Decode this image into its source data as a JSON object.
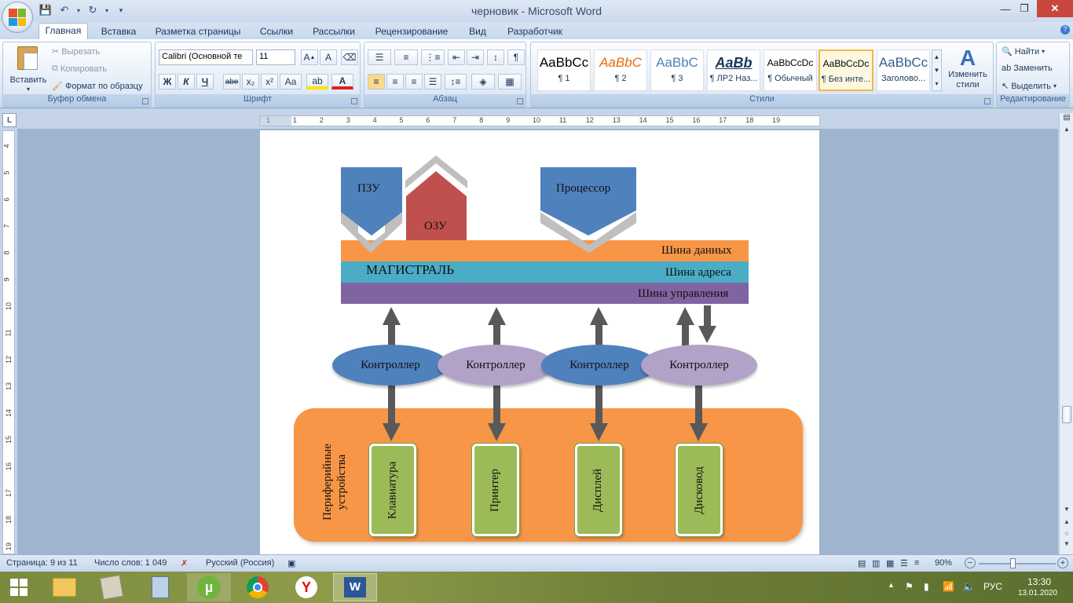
{
  "window": {
    "title": "черновик - Microsoft Word",
    "controls": [
      "—",
      "❐",
      "✕"
    ]
  },
  "tabs": [
    "Главная",
    "Вставка",
    "Разметка страницы",
    "Ссылки",
    "Рассылки",
    "Рецензирование",
    "Вид",
    "Разработчик"
  ],
  "clipboard": {
    "paste": "Вставить",
    "cut": "Вырезать",
    "copy": "Копировать",
    "format_painter": "Формат по образцу",
    "label": "Буфер обмена"
  },
  "font": {
    "family": "Calibri (Основной те",
    "size": "11",
    "label": "Шрифт",
    "buttons": [
      "Ж",
      "К",
      "Ч",
      "abe",
      "x₂",
      "x²",
      "Aa"
    ]
  },
  "paragraph": {
    "label": "Абзац"
  },
  "styles": {
    "label": "Стили",
    "items": [
      {
        "preview": "AaBbCc",
        "name": "¶ 1"
      },
      {
        "preview": "AaBbC",
        "name": "¶ 2"
      },
      {
        "preview": "AaBbC",
        "name": "¶ 3"
      },
      {
        "preview": "AaBb",
        "name": "¶ ЛР2 Наз..."
      },
      {
        "preview": "AaBbCcDc",
        "name": "¶ Обычный"
      },
      {
        "preview": "AaBbCcDc",
        "name": "¶ Без инте..."
      },
      {
        "preview": "AaBbCc",
        "name": "Заголово..."
      }
    ],
    "change": "Изменить стили"
  },
  "editing": {
    "label": "Редактирование",
    "find": "Найти",
    "replace": "Заменить",
    "select": "Выделить"
  },
  "ruler": {
    "marks": [
      "1",
      "1",
      "2",
      "3",
      "4",
      "5",
      "6",
      "7",
      "8",
      "9",
      "10",
      "11",
      "12",
      "13",
      "14",
      "15",
      "16",
      "17",
      "18",
      "19"
    ],
    "vmarks": [
      "4",
      "5",
      "6",
      "7",
      "8",
      "9",
      "10",
      "11",
      "12",
      "13",
      "14",
      "15",
      "16",
      "17",
      "18",
      "19"
    ],
    "corner": "L"
  },
  "diagram": {
    "rom": "ПЗУ",
    "ram": "ОЗУ",
    "cpu": "Процессор",
    "bus_main": "МАГИСТРАЛЬ",
    "data_bus": "Шина данных",
    "addr_bus": "Шина адреса",
    "ctrl_bus": "Шина управления",
    "controllers": [
      "Контроллер",
      "Контроллер",
      "Контроллер",
      "Контроллер"
    ],
    "peripherals_title_1": "Периферийные",
    "peripherals_title_2": "устройства",
    "devices": [
      "Клавиатура",
      "Принтер",
      "Дисплей",
      "Дисковод"
    ],
    "colors": {
      "blue": "#4f81bd",
      "red": "#c0504d",
      "orange": "#f79646",
      "teal": "#4bacc6",
      "purple": "#8064a2",
      "lavender": "#b3a2c7",
      "green": "#9bbb59",
      "arrow": "#595959"
    }
  },
  "status": {
    "page": "Страница: 9 из 11",
    "words": "Число слов: 1 049",
    "language": "Русский (Россия)",
    "zoom": "90%",
    "zoom_level": 0.9
  },
  "taskbar": {
    "lang": "РУС",
    "time": "13:30",
    "date": "13.01.2020"
  }
}
